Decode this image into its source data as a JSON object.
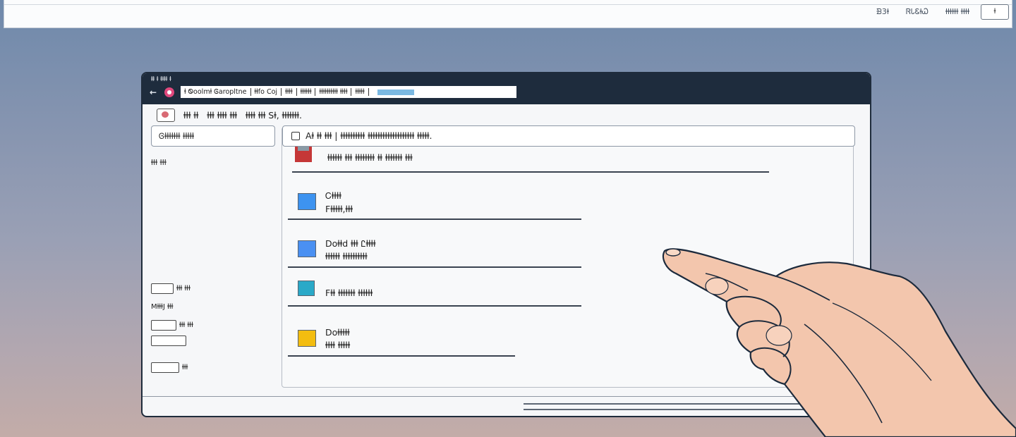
{
  "topbar": {
    "menu": [
      "ᗿ3ⱡ",
      "ᏒᏓᏋⱡᏇ",
      "ⱡⱡⱡⱡⱡⱡ ⱡⱡⱡⱡ"
    ],
    "btn": "ⱡ"
  },
  "window": {
    "titlebar_text": "ⱡⱡ ⱡ ⱡⱡⱡⱡ ⱡ",
    "address_segments": [
      "ⱡ Ꮻoolmⱡ Ꮆaropltne",
      "ⱡⱡfo Coj",
      "ⱡⱡⱡⱡ",
      "ⱡⱡⱡⱡⱡⱡ",
      "ⱡⱡⱡⱡⱡⱡⱡⱡⱡⱡ ⱡⱡⱡⱡ",
      "ⱡⱡⱡⱡⱡ"
    ],
    "toolbar_text": [
      "ⱡⱡⱡ ⱡⱡ",
      "ⱡⱡⱡ ⱡⱡⱡⱡ ⱡⱡⱡ",
      "ⱡⱡⱡⱡ ⱡⱡⱡ Sⱡ, ⱡⱡⱡⱡⱡⱡⱡ."
    ],
    "sidebar": {
      "search_text": "Ꮆⱡⱡⱡⱡⱡⱡⱡ ⱡⱡⱡⱡⱡ",
      "label": "ⱡⱡⱡ ⱡⱡⱡ",
      "small_1": "ⱡⱡⱡ ⱡⱡⱡ",
      "small_2": "MⱡⱡⱡJ  ⱡⱡⱡ",
      "small_3": "ⱡⱡⱡ ⱡⱡⱡ",
      "small_4": "ⱡⱡⱡ"
    },
    "main_search_text": "Aⱡ ⱡⱡ ⱡⱡⱡ | ⱡⱡⱡⱡⱡⱡⱡⱡⱡⱡ ⱡⱡⱡⱡⱡⱡⱡⱡⱡⱡⱡⱡⱡⱡⱡⱡⱡⱡⱡ ⱡⱡⱡⱡⱡ.",
    "first_item": "ⱡⱡⱡⱡⱡⱡ ⱡⱡⱡ ⱡⱡⱡⱡⱡⱡⱡⱡ ⱡⱡ ⱡⱡⱡⱡⱡⱡⱡ ⱡⱡⱡ",
    "items": [
      {
        "line1": "Ꮯⱡⱡⱡⱡ",
        "line2": "Fⱡⱡⱡⱡⱡ,ⱡⱡⱡ",
        "color": "#3d93f0"
      },
      {
        "line1": "Doⱡⱡd ⱡⱡⱡ   Ꮭⱡⱡⱡⱡ",
        "line2": "ⱡⱡⱡⱡⱡⱡ ⱡⱡⱡⱡⱡⱡⱡⱡⱡⱡ",
        "color": "#4a90f2"
      },
      {
        "line1": "",
        "line2": "Fⱡⱡ ⱡⱡⱡⱡⱡⱡⱡ ⱡⱡⱡⱡⱡⱡ",
        "color": "#2aa9c8"
      },
      {
        "line1": "Doⱡⱡⱡⱡⱡ",
        "line2": "ⱡⱡⱡⱡ ⱡⱡⱡⱡⱡ",
        "color": "#f3bd10"
      }
    ]
  }
}
